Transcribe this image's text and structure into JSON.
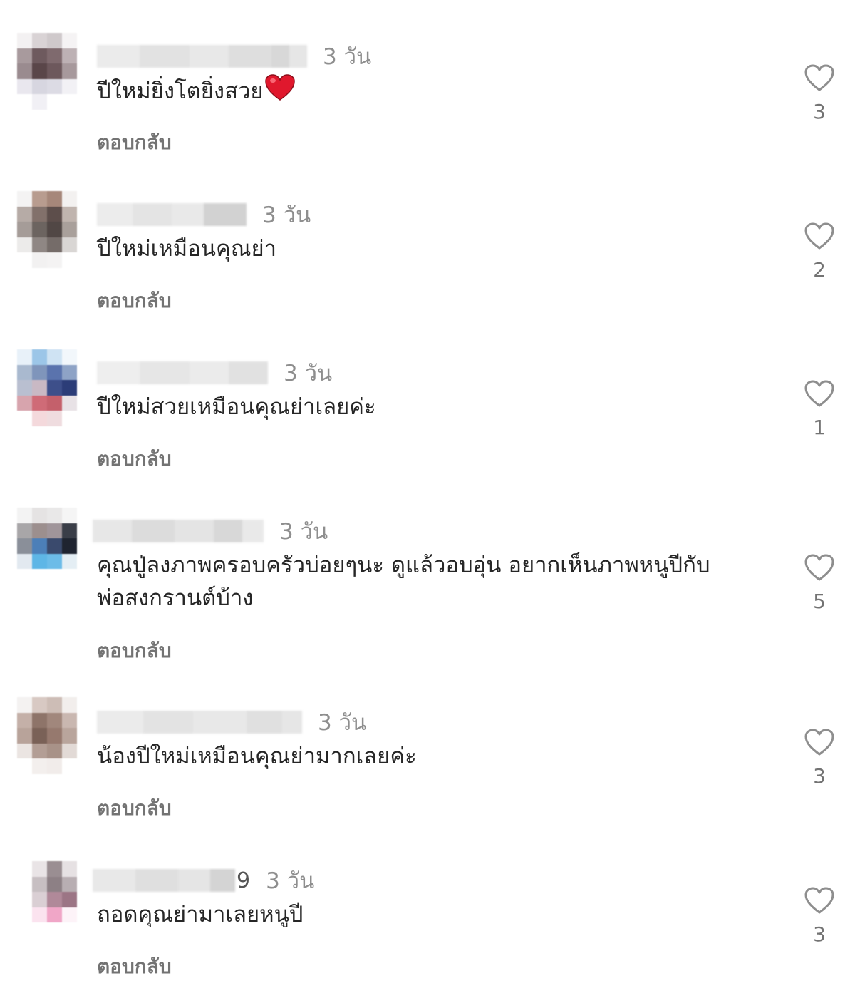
{
  "comments": [
    {
      "username_visible": "",
      "time": "3 วัน",
      "text": "ปีใหม่ยิ่งโตยิ่งสวย",
      "emoji": "red-heart",
      "reply_label": "ตอบกลับ",
      "likes": "3"
    },
    {
      "username_visible": "",
      "time": "3 วัน",
      "text": "ปีใหม่เหมือนคุณย่า",
      "reply_label": "ตอบกลับ",
      "likes": "2"
    },
    {
      "username_visible": "",
      "time": "3 วัน",
      "text": "ปีใหม่สวยเหมือนคุณย่าเลยค่ะ",
      "reply_label": "ตอบกลับ",
      "likes": "1"
    },
    {
      "username_visible": "",
      "time": "3 วัน",
      "text": "คุณปู่ลงภาพครอบครัวบ่อยๆนะ ดูแล้วอบอุ่น อยากเห็นภาพหนูปีกับ\nพ่อสงกรานต์บ้าง",
      "reply_label": "ตอบกลับ",
      "likes": "5"
    },
    {
      "username_visible": "",
      "time": "3 วัน",
      "text": "น้องปีใหม่เหมือนคุณย่ามากเลยค่ะ",
      "reply_label": "ตอบกลับ",
      "likes": "3"
    },
    {
      "username_visible": "9",
      "time": "3 วัน",
      "text": "ถอดคุณย่ามาเลยหนูปี",
      "reply_label": "ตอบกลับ",
      "likes": "3"
    }
  ],
  "icons": {
    "like": "heart-outline-icon",
    "emoji": "red-heart-emoji"
  },
  "colors": {
    "text": "#262626",
    "secondary": "#8e8e8e",
    "reply": "#737373",
    "heart_emoji": "#e0182d"
  }
}
